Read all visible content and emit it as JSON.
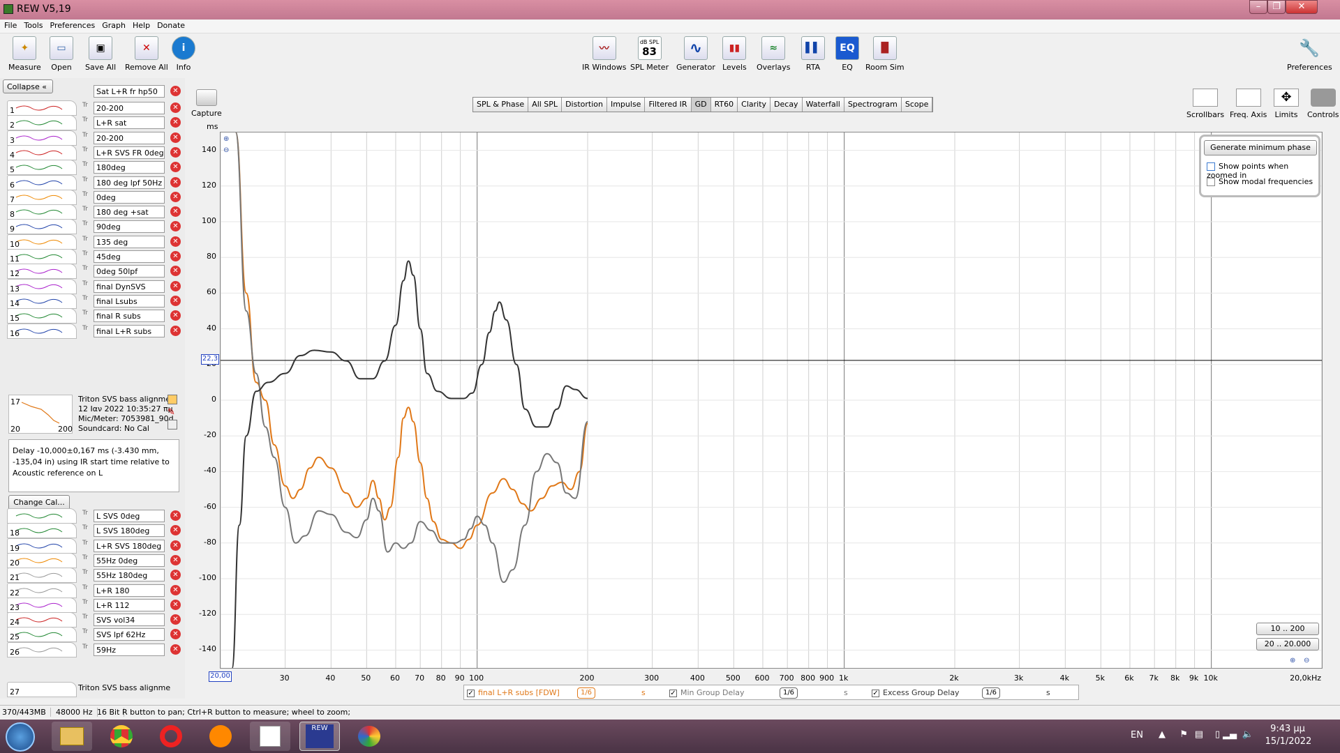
{
  "window": {
    "title": "REW V5,19"
  },
  "menu": [
    "File",
    "Tools",
    "Preferences",
    "Graph",
    "Help",
    "Donate"
  ],
  "toolbar_left": [
    {
      "label": "Measure",
      "icon": "microphone-icon"
    },
    {
      "label": "Open",
      "icon": "folder-icon"
    },
    {
      "label": "Save All",
      "icon": "save-icon"
    },
    {
      "label": "Remove All",
      "icon": "remove-all-icon"
    },
    {
      "label": "Info",
      "icon": "info-icon"
    }
  ],
  "toolbar_center": [
    {
      "label": "IR Windows",
      "icon": "ir-windows-icon",
      "glyph": "〰"
    },
    {
      "label": "SPL Meter",
      "icon": "spl-meter-icon",
      "glyph": "83",
      "caption": "dB SPL"
    },
    {
      "label": "Generator",
      "icon": "generator-icon",
      "glyph": "∿"
    },
    {
      "label": "Levels",
      "icon": "levels-icon",
      "glyph": "▮▮"
    },
    {
      "label": "Overlays",
      "icon": "overlays-icon",
      "glyph": "≈"
    },
    {
      "label": "RTA",
      "icon": "rta-icon",
      "glyph": "▌▌"
    },
    {
      "label": "EQ",
      "icon": "eq-icon",
      "glyph": "EQ"
    },
    {
      "label": "Room Sim",
      "icon": "room-sim-icon",
      "glyph": "▐▌"
    }
  ],
  "toolbar_right": {
    "label": "Preferences",
    "icon": "wrench-icon"
  },
  "left_panel": {
    "collapse_label": "Collapse",
    "top_name": "Sat L+R fr hp50",
    "measurements": [
      {
        "num": "1",
        "name": "20-200"
      },
      {
        "num": "2",
        "name": "L+R sat"
      },
      {
        "num": "3",
        "name": "20-200"
      },
      {
        "num": "4",
        "name": "L+R SVS FR 0deg"
      },
      {
        "num": "5",
        "name": "180deg"
      },
      {
        "num": "6",
        "name": "180 deg lpf 50Hz"
      },
      {
        "num": "7",
        "name": "0deg"
      },
      {
        "num": "8",
        "name": "180 deg +sat"
      },
      {
        "num": "9",
        "name": "90deg"
      },
      {
        "num": "10",
        "name": "135 deg"
      },
      {
        "num": "11",
        "name": "45deg"
      },
      {
        "num": "12",
        "name": "0deg 50lpf"
      },
      {
        "num": "13",
        "name": "final DynSVS"
      },
      {
        "num": "14",
        "name": "final Lsubs"
      },
      {
        "num": "15",
        "name": "final R subs"
      },
      {
        "num": "16",
        "name": "final L+R subs"
      }
    ],
    "selected": {
      "num": "17",
      "thumb_from": "20",
      "thumb_to": "200",
      "lines": [
        "Triton SVS bass alignme",
        "12 Ιαν 2022 10:35:27 πμ",
        "Mic/Meter: 7053981_90d",
        "Soundcard: No Cal"
      ]
    },
    "delay_text": "Delay -10,000±0,167 ms (-3.430 mm, -135,04 in) using IR start time relative to Acoustic reference on  L",
    "change_cal_label": "Change Cal...",
    "measurements2": [
      {
        "num": "",
        "name": "L SVS 0deg"
      },
      {
        "num": "18",
        "name": "L  SVS 180deg"
      },
      {
        "num": "19",
        "name": "L+R SVS 180deg"
      },
      {
        "num": "20",
        "name": "55Hz 0deg"
      },
      {
        "num": "21",
        "name": "55Hz 180deg"
      },
      {
        "num": "22",
        "name": "L+R 180"
      },
      {
        "num": "23",
        "name": "L+R 112"
      },
      {
        "num": "24",
        "name": "SVS vol34"
      },
      {
        "num": "25",
        "name": "SVS lpf 62Hz"
      },
      {
        "num": "26",
        "name": "59Hz"
      }
    ],
    "last_row": {
      "num": "27",
      "text": "Triton SVS bass alignme"
    }
  },
  "graph_tabs": [
    "SPL & Phase",
    "All SPL",
    "Distortion",
    "Impulse",
    "Filtered IR",
    "GD",
    "RT60",
    "Clarity",
    "Decay",
    "Waterfall",
    "Spectrogram",
    "Scope"
  ],
  "selected_tab": "GD",
  "capture_label": "Capture",
  "right_tools": [
    "Scrollbars",
    "Freq. Axis",
    "Limits",
    "Controls"
  ],
  "controls_panel": {
    "generate_label": "Generate minimum phase",
    "show_points": "Show points when zoomed in",
    "show_modal": "Show modal frequencies"
  },
  "range_buttons": [
    "10 .. 200",
    "20 .. 20.000"
  ],
  "y_axis_unit": "ms",
  "cursor_value": "22,3",
  "x_start_label": "20,00",
  "chart_data": {
    "type": "line",
    "ylabel": "ms",
    "xlabel": "",
    "x_scale": "log",
    "xlim": [
      20,
      20000
    ],
    "ylim": [
      -150,
      150
    ],
    "yticks": [
      140,
      120,
      100,
      80,
      60,
      40,
      20,
      0,
      -20,
      -40,
      -60,
      -80,
      -100,
      -120,
      -140
    ],
    "xticks": [
      {
        "v": 30,
        "l": "30"
      },
      {
        "v": 40,
        "l": "40"
      },
      {
        "v": 50,
        "l": "50"
      },
      {
        "v": 60,
        "l": "60"
      },
      {
        "v": 70,
        "l": "70"
      },
      {
        "v": 80,
        "l": "80"
      },
      {
        "v": 90,
        "l": "90"
      },
      {
        "v": 100,
        "l": "100"
      },
      {
        "v": 200,
        "l": "200"
      },
      {
        "v": 300,
        "l": "300"
      },
      {
        "v": 400,
        "l": "400"
      },
      {
        "v": 500,
        "l": "500"
      },
      {
        "v": 600,
        "l": "600"
      },
      {
        "v": 700,
        "l": "700"
      },
      {
        "v": 800,
        "l": "800"
      },
      {
        "v": 900,
        "l": "900"
      },
      {
        "v": 1000,
        "l": "1k"
      },
      {
        "v": 2000,
        "l": "2k"
      },
      {
        "v": 3000,
        "l": "3k"
      },
      {
        "v": 4000,
        "l": "4k"
      },
      {
        "v": 5000,
        "l": "5k"
      },
      {
        "v": 6000,
        "l": "6k"
      },
      {
        "v": 7000,
        "l": "7k"
      },
      {
        "v": 8000,
        "l": "8k"
      },
      {
        "v": 9000,
        "l": "9k"
      },
      {
        "v": 10000,
        "l": "10k"
      },
      {
        "v": 20000,
        "l": "20,0kHz"
      }
    ],
    "cursor_y": 22.3,
    "grid": true,
    "series": [
      {
        "name": "final L+R subs [FDW]",
        "color": "#e07818",
        "points": [
          [
            22,
            150
          ],
          [
            23.5,
            60
          ],
          [
            25,
            10
          ],
          [
            26.5,
            0
          ],
          [
            28,
            -25
          ],
          [
            30,
            -48
          ],
          [
            31.5,
            -55
          ],
          [
            33,
            -50
          ],
          [
            35,
            -38
          ],
          [
            37,
            -32
          ],
          [
            40,
            -38
          ],
          [
            44,
            -52
          ],
          [
            47,
            -60
          ],
          [
            50,
            -55
          ],
          [
            52,
            -45
          ],
          [
            54,
            -55
          ],
          [
            56,
            -67
          ],
          [
            58,
            -60
          ],
          [
            61,
            -32
          ],
          [
            63,
            -10
          ],
          [
            65,
            -4
          ],
          [
            67,
            -12
          ],
          [
            70,
            -35
          ],
          [
            73,
            -55
          ],
          [
            76,
            -68
          ],
          [
            80,
            -78
          ],
          [
            85,
            -80
          ],
          [
            90,
            -83
          ],
          [
            95,
            -78
          ],
          [
            100,
            -70
          ],
          [
            110,
            -52
          ],
          [
            118,
            -44
          ],
          [
            125,
            -50
          ],
          [
            133,
            -58
          ],
          [
            140,
            -62
          ],
          [
            150,
            -55
          ],
          [
            160,
            -48
          ],
          [
            170,
            -46
          ],
          [
            180,
            -50
          ],
          [
            190,
            -40
          ],
          [
            200,
            -13
          ]
        ]
      },
      {
        "name": "Min Group Delay",
        "color": "#777777",
        "points": [
          [
            22,
            150
          ],
          [
            23.5,
            50
          ],
          [
            25,
            15
          ],
          [
            26.5,
            -15
          ],
          [
            28,
            -32
          ],
          [
            30,
            -60
          ],
          [
            32,
            -80
          ],
          [
            34,
            -76
          ],
          [
            37,
            -62
          ],
          [
            40,
            -64
          ],
          [
            44,
            -74
          ],
          [
            47,
            -77
          ],
          [
            50,
            -67
          ],
          [
            52,
            -55
          ],
          [
            54,
            -62
          ],
          [
            57,
            -85
          ],
          [
            60,
            -80
          ],
          [
            63,
            -83
          ],
          [
            66,
            -80
          ],
          [
            70,
            -68
          ],
          [
            75,
            -73
          ],
          [
            80,
            -80
          ],
          [
            87,
            -80
          ],
          [
            92,
            -78
          ],
          [
            96,
            -72
          ],
          [
            100,
            -65
          ],
          [
            105,
            -70
          ],
          [
            110,
            -80
          ],
          [
            118,
            -102
          ],
          [
            125,
            -95
          ],
          [
            135,
            -70
          ],
          [
            145,
            -40
          ],
          [
            155,
            -30
          ],
          [
            165,
            -35
          ],
          [
            175,
            -52
          ],
          [
            185,
            -55
          ],
          [
            200,
            -12
          ]
        ]
      },
      {
        "name": "Excess Group Delay",
        "color": "#333333",
        "points": [
          [
            21.5,
            -150
          ],
          [
            22.5,
            -70
          ],
          [
            23.5,
            -20
          ],
          [
            25,
            5
          ],
          [
            27,
            10
          ],
          [
            30,
            15
          ],
          [
            33,
            25
          ],
          [
            36,
            28
          ],
          [
            40,
            27
          ],
          [
            44,
            22
          ],
          [
            48,
            12
          ],
          [
            52,
            12
          ],
          [
            56,
            22
          ],
          [
            60,
            42
          ],
          [
            63,
            67
          ],
          [
            65,
            78
          ],
          [
            67,
            70
          ],
          [
            70,
            40
          ],
          [
            73,
            15
          ],
          [
            78,
            5
          ],
          [
            85,
            1
          ],
          [
            92,
            1
          ],
          [
            97,
            4
          ],
          [
            103,
            20
          ],
          [
            108,
            38
          ],
          [
            112,
            50
          ],
          [
            115,
            55
          ],
          [
            120,
            45
          ],
          [
            128,
            20
          ],
          [
            135,
            -5
          ],
          [
            145,
            -15
          ],
          [
            155,
            -15
          ],
          [
            165,
            -5
          ],
          [
            175,
            8
          ],
          [
            185,
            6
          ],
          [
            200,
            1
          ]
        ]
      }
    ]
  },
  "legend": [
    {
      "name": "final L+R subs [FDW]",
      "smooth": "1/6",
      "unit": "s",
      "color": "#e07818",
      "checked": true
    },
    {
      "name": "Min Group Delay",
      "smooth": "1/6",
      "unit": "s",
      "color": "#777777",
      "checked": true
    },
    {
      "name": "Excess Group Delay",
      "smooth": "1/6",
      "unit": "s",
      "color": "#333333",
      "checked": true
    }
  ],
  "status": {
    "memory": "370/443MB",
    "rate": "48000 Hz",
    "bits": "16 Bit",
    "hint": "R button to pan; Ctrl+R button to measure; wheel to zoom;"
  },
  "taskbar": {
    "apps": [
      "explorer-icon",
      "chrome-icon",
      "opera-icon",
      "brave-icon",
      "notepad-icon",
      "rew-icon",
      "paint-icon"
    ],
    "lang": "EN",
    "time": "9:43 μμ",
    "date": "15/1/2022"
  }
}
